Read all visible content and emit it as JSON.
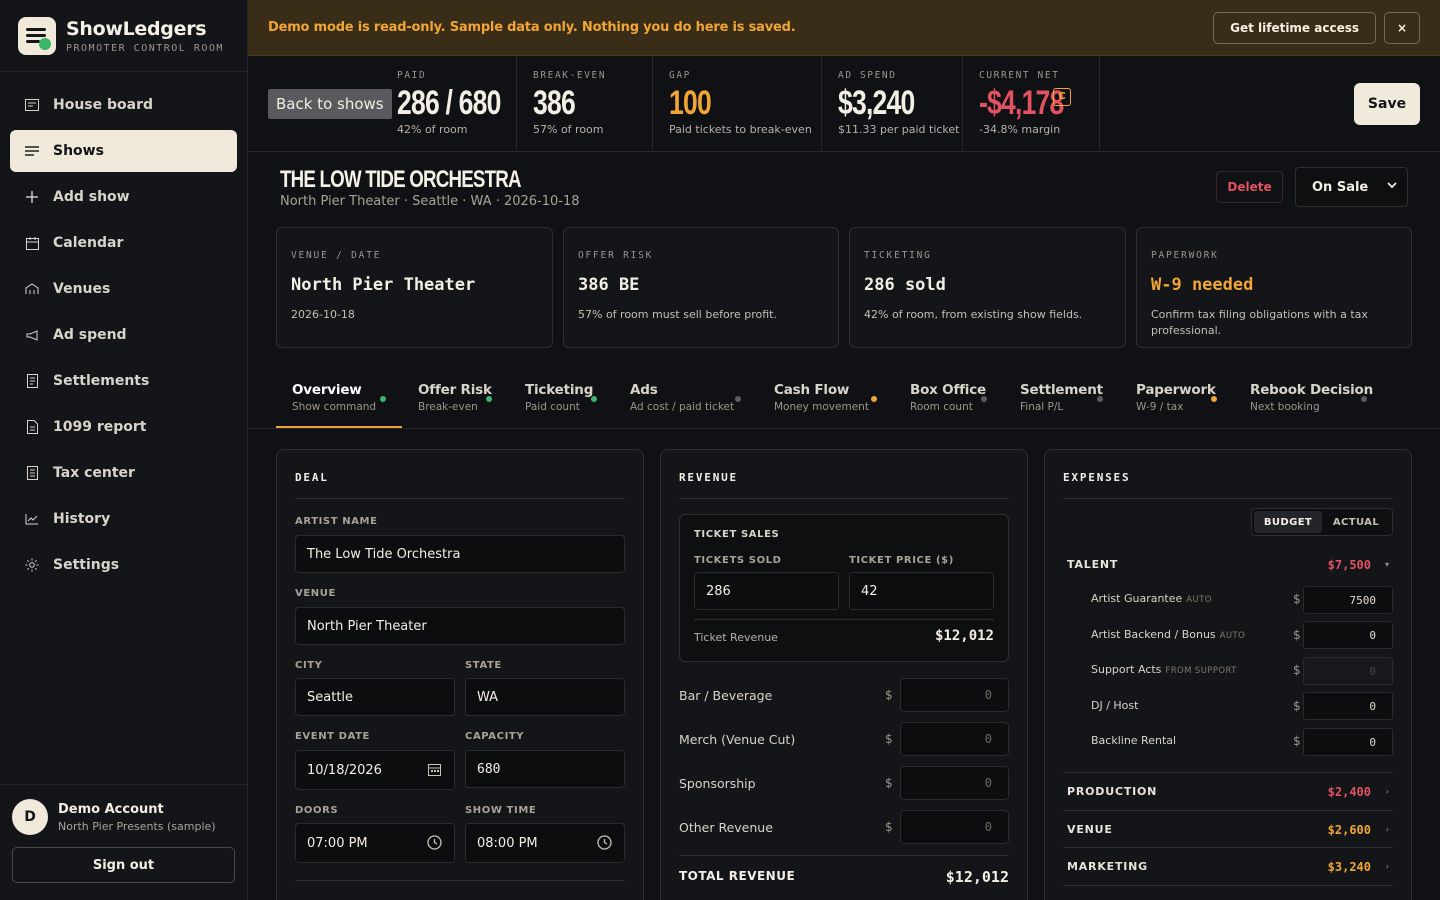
{
  "brand": {
    "name": "ShowLedgers",
    "tagline": "PROMOTER CONTROL ROOM"
  },
  "nav": [
    {
      "label": "House board",
      "icon": "house-board-icon"
    },
    {
      "label": "Shows",
      "icon": "list-icon",
      "active": true
    },
    {
      "label": "Add show",
      "icon": "plus-icon"
    },
    {
      "label": "Calendar",
      "icon": "calendar-icon"
    },
    {
      "label": "Venues",
      "icon": "venue-icon"
    },
    {
      "label": "Ad spend",
      "icon": "megaphone-icon"
    },
    {
      "label": "Settlements",
      "icon": "receipt-icon"
    },
    {
      "label": "1099 report",
      "icon": "document-icon"
    },
    {
      "label": "Tax center",
      "icon": "ledger-icon"
    },
    {
      "label": "History",
      "icon": "chart-line-icon"
    },
    {
      "label": "Settings",
      "icon": "gear-icon"
    }
  ],
  "account": {
    "initial": "D",
    "name": "Demo Account",
    "org": "North Pier Presents (sample)",
    "signout": "Sign out"
  },
  "banner": {
    "text": "Demo mode is read-only. Sample data only. Nothing you do here is saved.",
    "cta": "Get lifetime access",
    "close": "×"
  },
  "stats": {
    "back": "Back to shows",
    "items": [
      {
        "label": "PAID",
        "value": "286 / 680",
        "sub": "42% of room"
      },
      {
        "label": "BREAK-EVEN",
        "value": "386",
        "sub": "57% of room"
      },
      {
        "label": "GAP",
        "value": "100",
        "sub": "Paid tickets to break-even"
      },
      {
        "label": "AD SPEND",
        "value": "$3,240",
        "sub": "$11.33 per paid ticket"
      },
      {
        "label": "CURRENT NET",
        "value": "-$4,178",
        "sub": "-34.8% margin",
        "badge": "C"
      }
    ],
    "save": "Save",
    "colors": {
      "gap": "#f0a534",
      "negative": "#e25260"
    }
  },
  "show": {
    "title": "THE LOW TIDE ORCHESTRA",
    "subtitle": "North Pier Theater · Seattle · WA · 2026-10-18",
    "delete": "Delete",
    "status": "On Sale"
  },
  "cards": [
    {
      "label": "VENUE / DATE",
      "value": "North Pier Theater",
      "desc": "2026-10-18"
    },
    {
      "label": "OFFER RISK",
      "value": "386 BE",
      "desc": "57% of room must sell before profit."
    },
    {
      "label": "TICKETING",
      "value": "286 sold",
      "desc": "42% of room, from existing show fields."
    },
    {
      "label": "PAPERWORK",
      "value": "W-9 needed",
      "desc": "Confirm tax filing obligations with a tax professional.",
      "warn": true
    }
  ],
  "tabs": [
    {
      "title": "Overview",
      "sub": "Show command",
      "dot": "#3bb56a",
      "active": true
    },
    {
      "title": "Offer Risk",
      "sub": "Break-even",
      "dot": "#3bb56a"
    },
    {
      "title": "Ticketing",
      "sub": "Paid count",
      "dot": "#3bb56a"
    },
    {
      "title": "Ads",
      "sub": "Ad cost / paid ticket",
      "dot": "#5c5c60"
    },
    {
      "title": "Cash Flow",
      "sub": "Money movement",
      "dot": "#f0a534"
    },
    {
      "title": "Box Office",
      "sub": "Room count",
      "dot": "#5c5c60"
    },
    {
      "title": "Settlement",
      "sub": "Final P/L",
      "dot": "#5c5c60"
    },
    {
      "title": "Paperwork",
      "sub": "W-9 / tax",
      "dot": "#f0a534"
    },
    {
      "title": "Rebook Decision",
      "sub": "Next booking",
      "dot": "#5c5c60"
    }
  ],
  "deal": {
    "title": "DEAL",
    "artist_label": "ARTIST NAME",
    "artist": "The Low Tide Orchestra",
    "venue_label": "VENUE",
    "venue": "North Pier Theater",
    "city_label": "CITY",
    "city": "Seattle",
    "state_label": "STATE",
    "state": "WA",
    "date_label": "EVENT DATE",
    "date": "10/18/2026",
    "capacity_label": "CAPACITY",
    "capacity": "680",
    "doors_label": "DOORS",
    "doors": "07:00 PM",
    "showtime_label": "SHOW TIME",
    "showtime": "08:00 PM"
  },
  "revenue": {
    "title": "REVENUE",
    "ticket_sales_title": "TICKET SALES",
    "sold_label": "TICKETS SOLD",
    "sold": "286",
    "price_label": "TICKET PRICE ($)",
    "price": "42",
    "ticket_rev_label": "Ticket Revenue",
    "ticket_rev": "$12,012",
    "lines": [
      {
        "label": "Bar / Beverage",
        "value": "0"
      },
      {
        "label": "Merch (Venue Cut)",
        "value": "0"
      },
      {
        "label": "Sponsorship",
        "value": "0"
      },
      {
        "label": "Other Revenue",
        "value": "0"
      }
    ],
    "currency": "$",
    "total_label": "TOTAL REVENUE",
    "total": "$12,012"
  },
  "expenses": {
    "title": "EXPENSES",
    "toggle": [
      "BUDGET",
      "ACTUAL"
    ],
    "currency": "$",
    "talent": {
      "label": "TALENT",
      "total": "$7,500"
    },
    "talent_lines": [
      {
        "label": "Artist Guarantee",
        "tag": "AUTO",
        "value": "7500"
      },
      {
        "label": "Artist Backend / Bonus",
        "tag": "AUTO",
        "value": "0"
      },
      {
        "label": "Support Acts",
        "tag": "FROM SUPPORT",
        "value": "0",
        "disabled": true
      },
      {
        "label": "DJ / Host",
        "tag": "",
        "value": "0"
      },
      {
        "label": "Backline Rental",
        "tag": "",
        "value": "0"
      }
    ],
    "categories": [
      {
        "label": "PRODUCTION",
        "total": "$2,400"
      },
      {
        "label": "VENUE",
        "total": "$2,600"
      },
      {
        "label": "MARKETING",
        "total": "$3,240"
      }
    ],
    "colors": {
      "talent": "#e25260",
      "production": "#e25260",
      "venue": "#f0a534",
      "marketing": "#f0a534"
    }
  }
}
